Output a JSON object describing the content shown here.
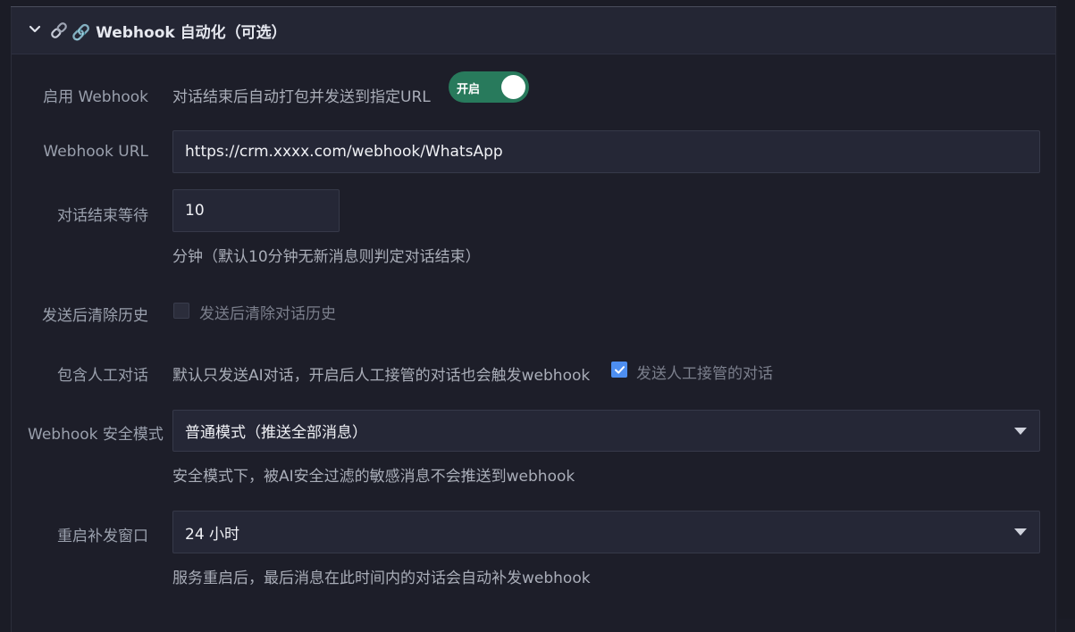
{
  "section": {
    "title": "🔗 Webhook 自动化（可选）",
    "icon": "link-icon",
    "expand_icon": "chevron-down-icon"
  },
  "enable_webhook": {
    "label": "启用 Webhook",
    "description": "对话结束后自动打包并发送到指定URL",
    "toggle_text": "开启",
    "enabled": true
  },
  "webhook_url": {
    "label": "Webhook URL",
    "value": "https://crm.xxxx.com/webhook/WhatsApp"
  },
  "end_wait": {
    "label": "对话结束等待",
    "value": "10",
    "hint": "分钟（默认10分钟无新消息则判定对话结束）"
  },
  "clear_history": {
    "label": "发送后清除历史",
    "checkbox_label": "发送后清除对话历史",
    "checked": false
  },
  "include_human": {
    "label": "包含人工对话",
    "description": "默认只发送AI对话，开启后人工接管的对话也会触发webhook",
    "checkbox_label": "发送人工接管的对话",
    "checked": true
  },
  "security_mode": {
    "label": "Webhook 安全模式",
    "selected": "普通模式（推送全部消息）",
    "hint": "安全模式下，被AI安全过滤的敏感消息不会推送到webhook"
  },
  "resend_window": {
    "label": "重启补发窗口",
    "selected": "24 小时",
    "hint": "服务重启后，最后消息在此时间内的对话会自动补发webhook"
  },
  "colors": {
    "background": "#1d1e29",
    "header": "#242634",
    "input": "#252736",
    "toggle_on": "#287a5c",
    "checkbox_on": "#4d8ef0"
  }
}
